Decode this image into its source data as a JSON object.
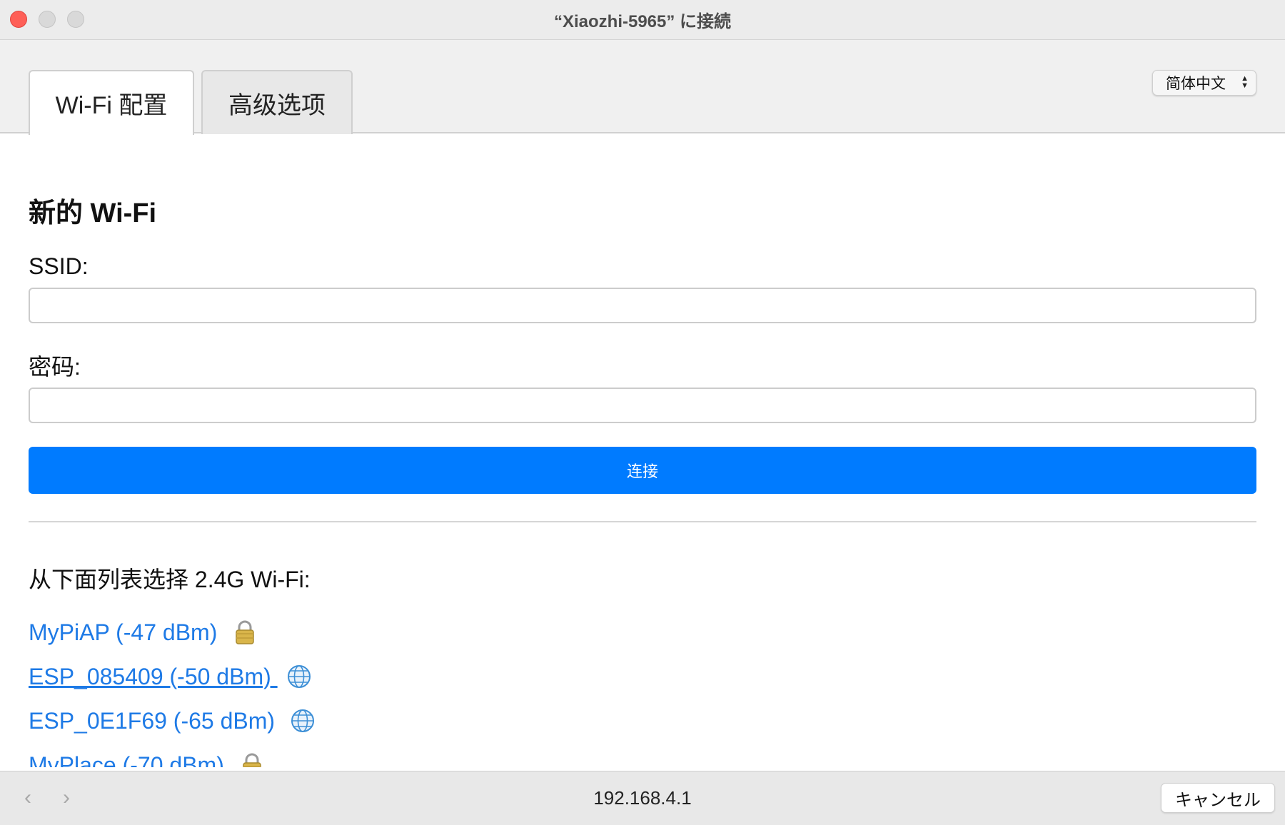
{
  "window": {
    "title": "“Xiaozhi-5965” に接続"
  },
  "tabs": [
    {
      "label": "Wi-Fi 配置",
      "active": true
    },
    {
      "label": "高级选项",
      "active": false
    }
  ],
  "language": {
    "selected": "简体中文"
  },
  "form": {
    "heading": "新的 Wi-Fi",
    "ssid_label": "SSID:",
    "ssid_value": "",
    "password_label": "密码:",
    "password_value": "",
    "connect_label": "连接"
  },
  "networks": {
    "title": "从下面列表选择 2.4G Wi-Fi:",
    "items": [
      {
        "label": "MyPiAP (-47 dBm) ",
        "icon": "lock-icon"
      },
      {
        "label": "ESP_085409 (-50 dBm) ",
        "icon": "globe-icon"
      },
      {
        "label": "ESP_0E1F69 (-65 dBm) ",
        "icon": "globe-icon"
      },
      {
        "label": "MyPlace (-70 dBm) ",
        "icon": "lock-icon"
      }
    ]
  },
  "bottom": {
    "url": "192.168.4.1",
    "cancel_label": "キャンセル"
  },
  "colors": {
    "accent": "#007bff",
    "link": "#1e7ae6",
    "close": "#fe5f57"
  }
}
